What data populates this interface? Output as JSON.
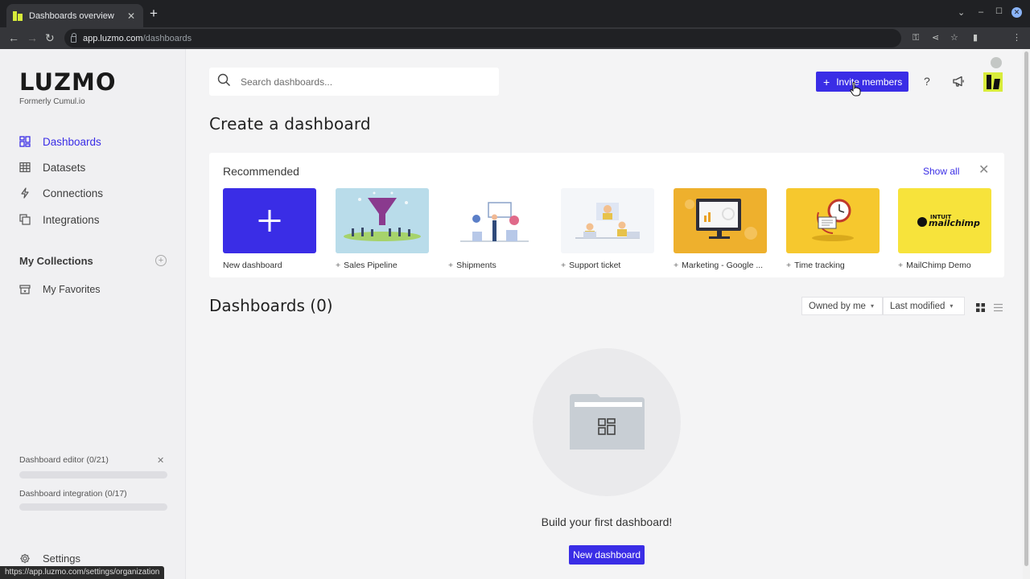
{
  "browser": {
    "tab_title": "Dashboards overview",
    "url_host": "app.luzmo.com",
    "url_path": "/dashboards",
    "status_url": "https://app.luzmo.com/settings/organization"
  },
  "sidebar": {
    "logo": "LUZMO",
    "logo_subtitle": "Formerly Cumul.io",
    "nav": [
      {
        "label": "Dashboards",
        "icon": "dashboards-icon",
        "active": true
      },
      {
        "label": "Datasets",
        "icon": "table-icon"
      },
      {
        "label": "Connections",
        "icon": "lightning-icon"
      },
      {
        "label": "Integrations",
        "icon": "integrations-icon"
      }
    ],
    "collections_title": "My Collections",
    "favorites_label": "My Favorites",
    "progress": [
      {
        "label": "Dashboard editor (0/21)",
        "value": 0
      },
      {
        "label": "Dashboard integration (0/17)",
        "value": 0
      }
    ],
    "settings_label": "Settings"
  },
  "header": {
    "search_placeholder": "Search dashboards...",
    "invite_label": "Invite members",
    "help_label": "?"
  },
  "create": {
    "title": "Create a dashboard",
    "recommended_title": "Recommended",
    "show_all": "Show all",
    "templates": [
      {
        "label": "New dashboard",
        "plus": false
      },
      {
        "label": "Sales Pipeline",
        "plus": true
      },
      {
        "label": "Shipments",
        "plus": true
      },
      {
        "label": "Support ticket",
        "plus": true
      },
      {
        "label": "Marketing - Google ...",
        "plus": true
      },
      {
        "label": "Time tracking",
        "plus": true
      },
      {
        "label": "MailChimp Demo",
        "plus": true
      }
    ],
    "mailchimp_logo_top": "INTUIT",
    "mailchimp_logo_bottom": "mailchimp"
  },
  "dashboards": {
    "title": "Dashboards (0)",
    "filter_owner": "Owned by me",
    "filter_sort": "Last modified",
    "empty_text": "Build your first dashboard!",
    "new_button": "New dashboard"
  },
  "colors": {
    "accent": "#3a2de6",
    "brand_yellow": "#d8ec3a"
  }
}
